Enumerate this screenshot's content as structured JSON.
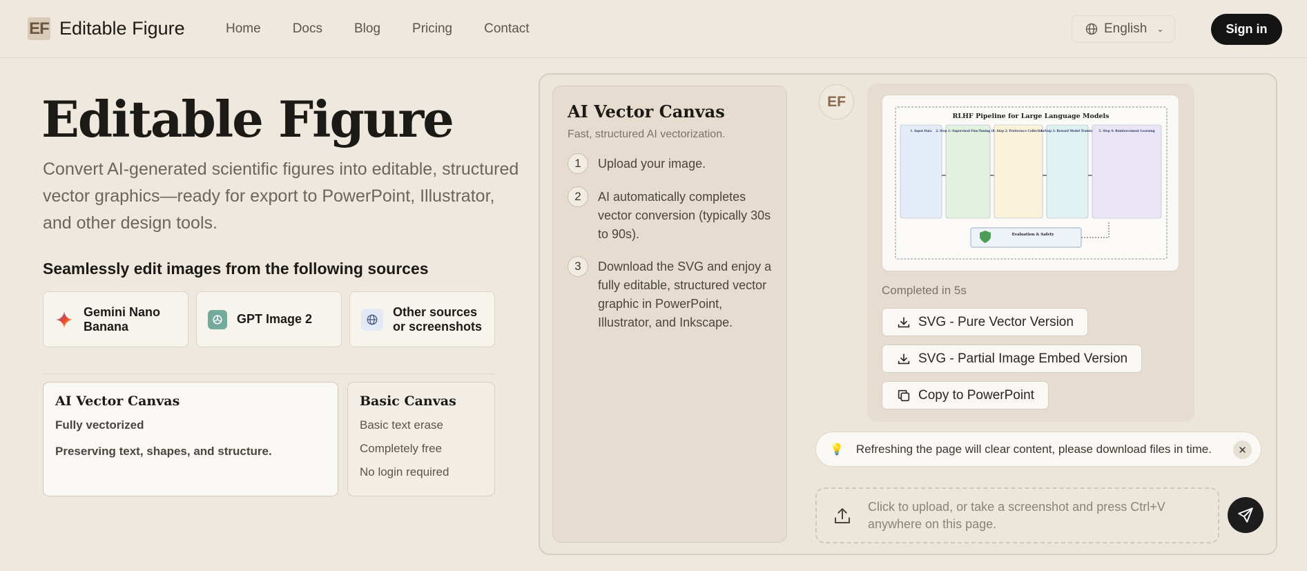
{
  "header": {
    "logo_text": "EF",
    "brand": "Editable Figure",
    "nav": [
      "Home",
      "Docs",
      "Blog",
      "Pricing",
      "Contact"
    ],
    "language": "English",
    "sign_in": "Sign in"
  },
  "hero": {
    "title": "Editable Figure",
    "description": "Convert AI-generated scientific figures into editable, structured vector graphics—ready for export to PowerPoint, Illustrator, and other design tools.",
    "sources_title": "Seamlessly edit images from the following sources",
    "sources": [
      {
        "label": "Gemini Nano Banana",
        "icon": "gemini-icon"
      },
      {
        "label": "GPT Image 2",
        "icon": "openai-icon"
      },
      {
        "label": "Other sources or screenshots",
        "icon": "globe-icon"
      }
    ]
  },
  "canvases": [
    {
      "title": "AI Vector Canvas",
      "features": [
        "Fully vectorized",
        "Preserving text, shapes, and structure."
      ]
    },
    {
      "title": "Basic Canvas",
      "features": [
        "Basic text erase",
        "Completely free",
        "No login required"
      ]
    }
  ],
  "steps_panel": {
    "title": "AI Vector Canvas",
    "subtitle": "Fast, structured AI vectorization.",
    "steps": [
      {
        "num": "1",
        "text": "Upload your image."
      },
      {
        "num": "2",
        "text": "AI automatically completes vector conversion (typically 30s to 90s)."
      },
      {
        "num": "3",
        "text": "Download the SVG and enjoy a fully editable, structured vector graphic in PowerPoint, Illustrator, and Inkscape."
      }
    ]
  },
  "result": {
    "avatar": "EF",
    "figure": {
      "title": "RLHF Pipeline for Large Language Models",
      "stages": [
        {
          "label": "1. Input Data",
          "color": "#e3ecf7"
        },
        {
          "label": "2. Step 1: Supervised Fine-Tuning (SFT)",
          "color": "#e2f1e0"
        },
        {
          "label": "3. Step 2: Preference Collection",
          "color": "#fbf3d9"
        },
        {
          "label": "4. Step 3: Reward Model Training",
          "color": "#dff2f1"
        },
        {
          "label": "5. Step 4: Reinforcement Learning",
          "color": "#ebe6f6"
        }
      ],
      "evaluation": "Evaluation & Safety"
    },
    "completed": "Completed in 5s",
    "buttons": [
      {
        "label": "SVG - Pure Vector Version",
        "icon": "download-icon"
      },
      {
        "label": "SVG - Partial Image Embed Version",
        "icon": "download-icon"
      },
      {
        "label": "Copy to PowerPoint",
        "icon": "copy-icon"
      }
    ]
  },
  "notice": {
    "icon": "lightbulb-icon",
    "text": "Refreshing the page will clear content, please download files in time.",
    "close": "✕"
  },
  "upload": {
    "text": "Click to upload, or take a screenshot and press Ctrl+V anywhere on this page."
  },
  "colors": {
    "background": "#eee8de",
    "accent_dark": "#141414",
    "card": "#f7f3ed"
  }
}
